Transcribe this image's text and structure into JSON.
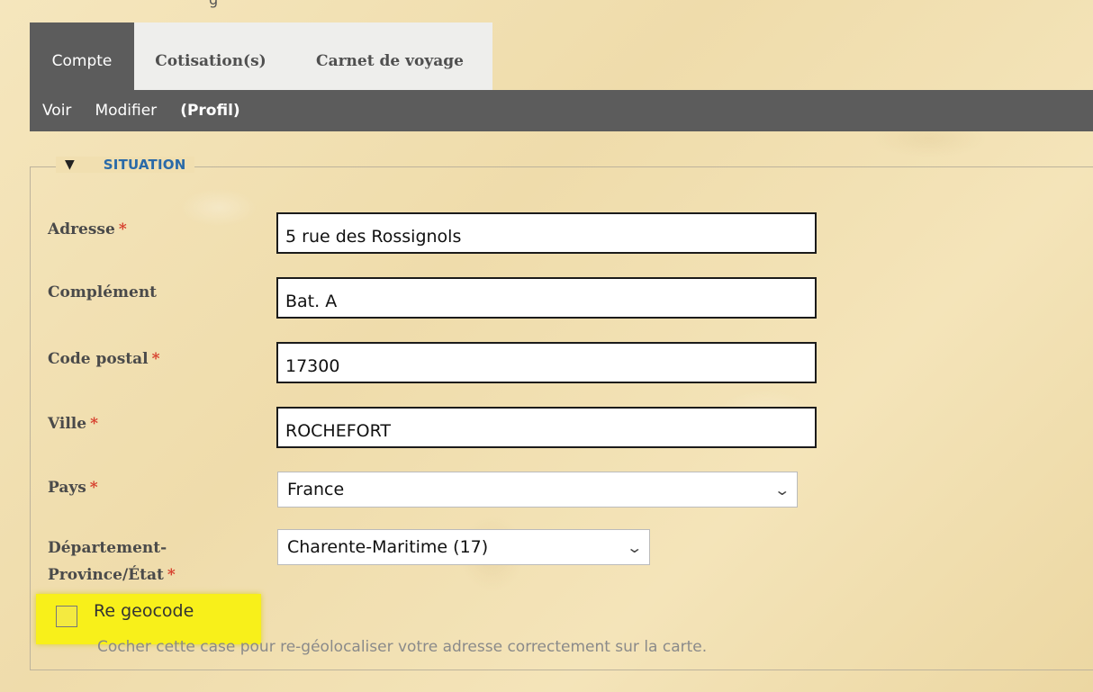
{
  "header_partial": "g",
  "tabs": [
    {
      "label": "Compte",
      "active": true
    },
    {
      "label": "Cotisation(s)",
      "active": false
    },
    {
      "label": "Carnet de voyage",
      "active": false
    }
  ],
  "subnav": [
    {
      "label": "Voir"
    },
    {
      "label": "Modifier"
    },
    {
      "label": "(Profil)",
      "current": true
    }
  ],
  "section": {
    "title": "SITUATION",
    "collapse_icon": "triangle-down-icon"
  },
  "fields": {
    "address": {
      "label": "Adresse",
      "required": "*",
      "value": "5 rue des Rossignols"
    },
    "complement": {
      "label": "Complément",
      "value": "Bat. A"
    },
    "postal_code": {
      "label": "Code postal",
      "required": "*",
      "value": "17300"
    },
    "city": {
      "label": "Ville",
      "required": "*",
      "value": "ROCHEFORT"
    },
    "country": {
      "label": "Pays",
      "required": "*",
      "value": "France"
    },
    "region": {
      "label_line1": "Département-",
      "label_line2": "Province/État",
      "required": "*",
      "value": "Charente-Maritime (17)"
    }
  },
  "regeocode": {
    "label": "Re geocode",
    "checked": false,
    "help": "Cocher cette case pour re-géolocaliser votre adresse correctement sur la carte."
  },
  "colors": {
    "accent": "#2a6aa8",
    "nav_bar": "#5c5c5c",
    "required": "#d63b2a",
    "highlight": "#f8f01a"
  }
}
